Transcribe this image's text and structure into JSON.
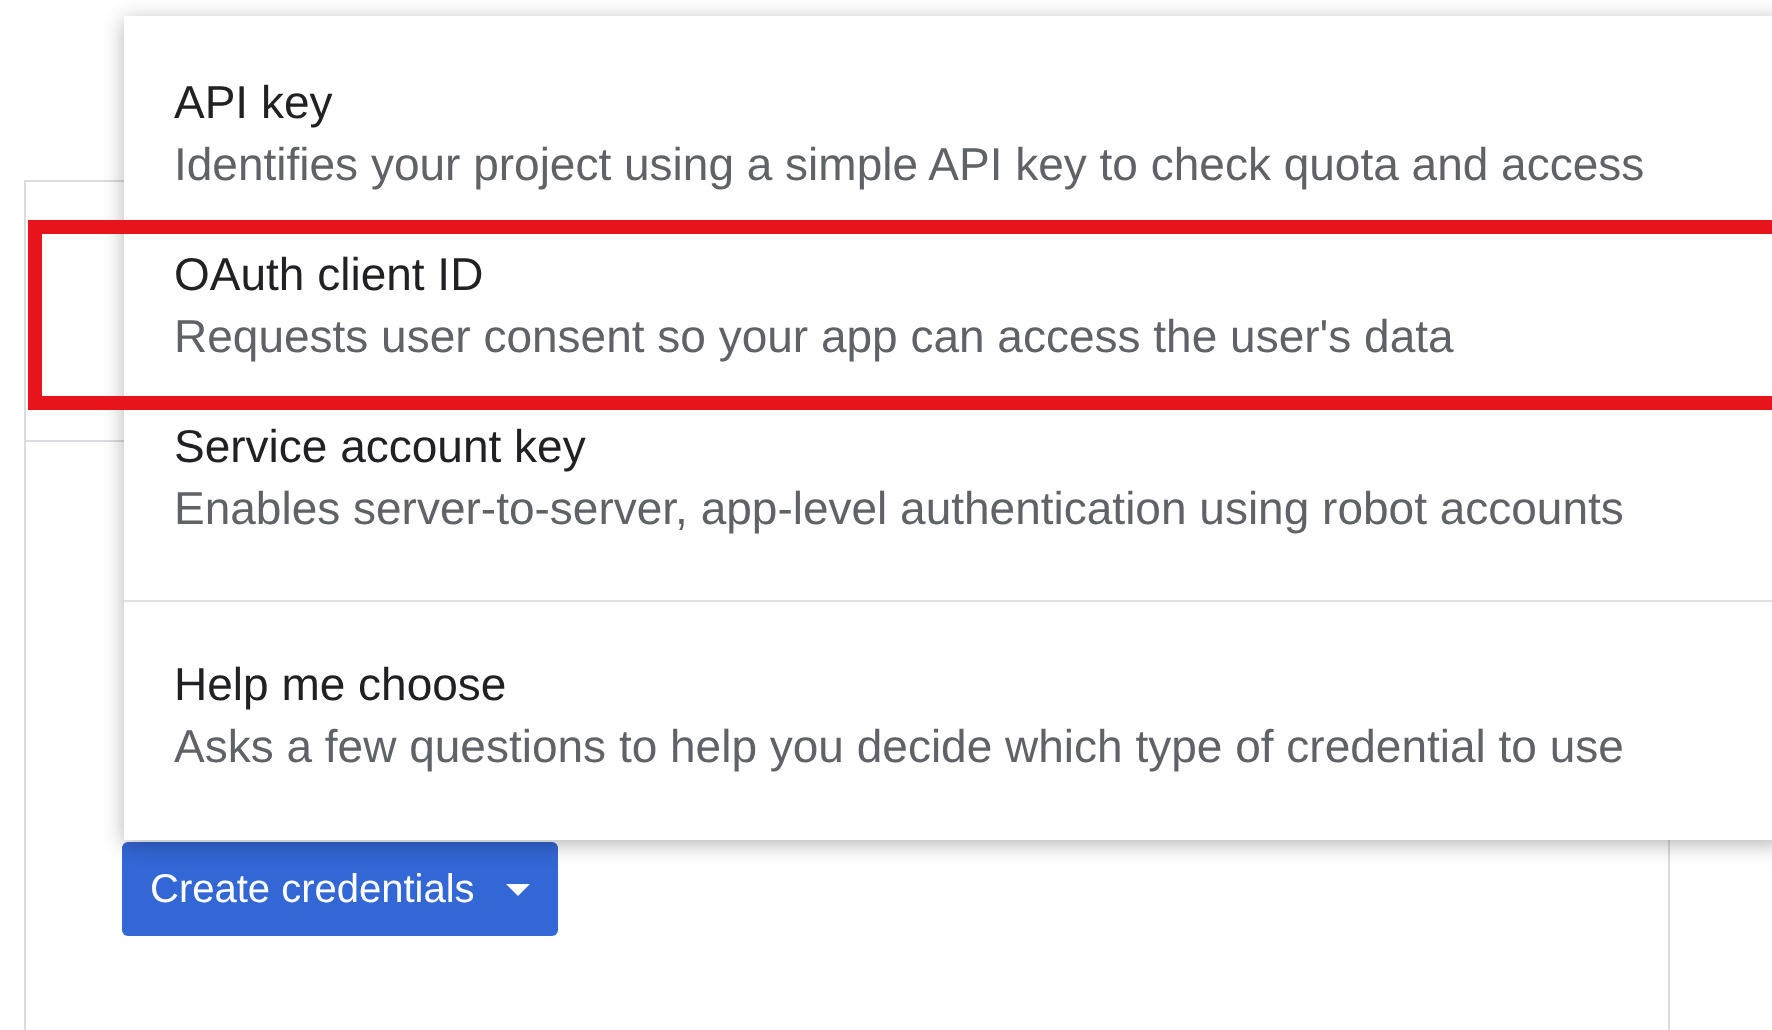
{
  "menu": {
    "sections": [
      [
        {
          "title": "API key",
          "description": "Identifies your project using a simple API key to check quota and access",
          "highlighted": false
        },
        {
          "title": "OAuth client ID",
          "description": "Requests user consent so your app can access the user's data",
          "highlighted": true
        },
        {
          "title": "Service account key",
          "description": "Enables server-to-server, app-level authentication using robot accounts",
          "highlighted": false
        }
      ],
      [
        {
          "title": "Help me choose",
          "description": "Asks a few questions to help you decide which type of credential to use",
          "highlighted": false
        }
      ]
    ]
  },
  "button": {
    "label": "Create credentials"
  }
}
